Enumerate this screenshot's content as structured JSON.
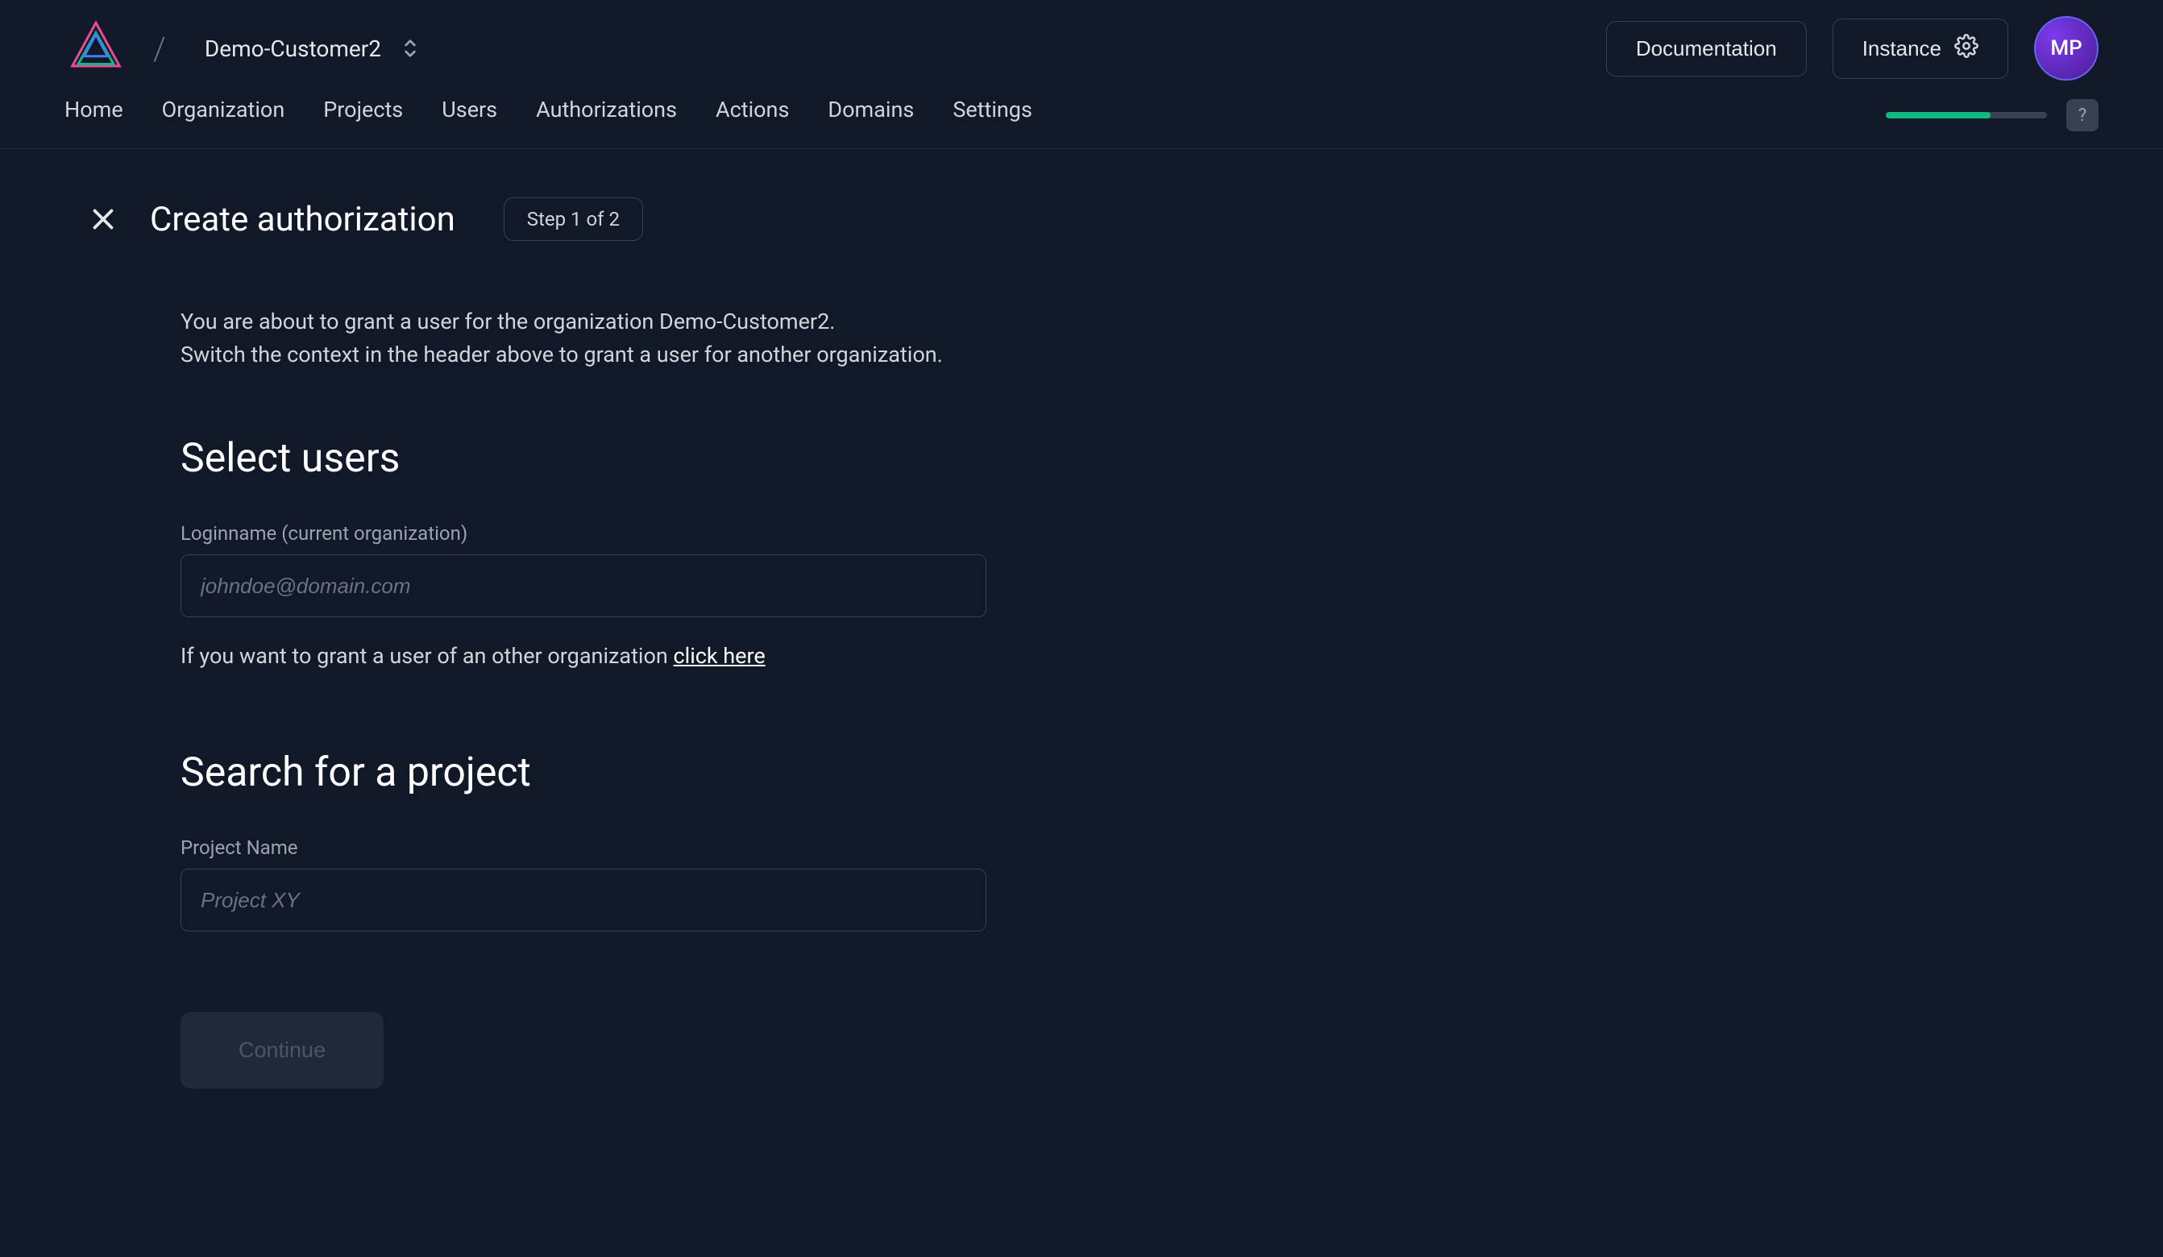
{
  "header": {
    "org_name": "Demo-Customer2",
    "documentation_label": "Documentation",
    "instance_label": "Instance",
    "avatar_initials": "MP"
  },
  "nav": {
    "tabs": [
      "Home",
      "Organization",
      "Projects",
      "Users",
      "Authorizations",
      "Actions",
      "Domains",
      "Settings"
    ],
    "progress_percent": 65,
    "help_symbol": "?"
  },
  "page": {
    "title": "Create authorization",
    "step_badge": "Step 1 of 2",
    "info_line1": "You are about to grant a user for the organization Demo-Customer2.",
    "info_line2": "Switch the context in the header above to grant a user for another organization."
  },
  "select_users": {
    "heading": "Select users",
    "login_label": "Loginname (current organization)",
    "login_placeholder": "johndoe@domain.com",
    "helper_prefix": "If you want to grant a user of an other organization ",
    "helper_link": "click here"
  },
  "search_project": {
    "heading": "Search for a project",
    "project_label": "Project Name",
    "project_placeholder": "Project XY"
  },
  "actions": {
    "continue_label": "Continue"
  }
}
